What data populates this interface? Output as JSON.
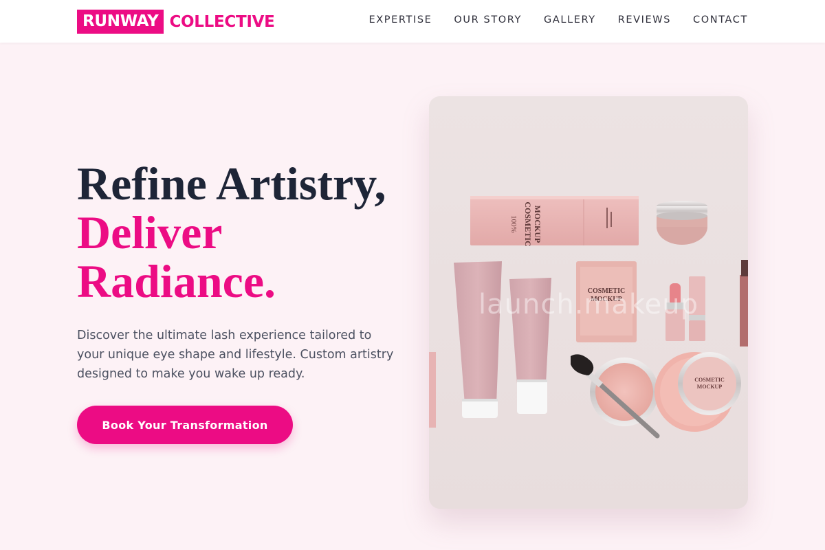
{
  "brand": {
    "logo_highlight": "RUNWAY",
    "logo_rest": "COLLECTIVE",
    "accent_color": "#ec0c84"
  },
  "nav": {
    "items": [
      {
        "label": "EXPERTISE"
      },
      {
        "label": "OUR STORY"
      },
      {
        "label": "GALLERY"
      },
      {
        "label": "REVIEWS"
      },
      {
        "label": "CONTACT"
      }
    ]
  },
  "hero": {
    "headline_line1": "Refine Artistry,",
    "headline_line2": "Deliver",
    "headline_line3": "Radiance.",
    "description": "Discover the ultimate lash experience tailored to your unique eye shape and lifestyle. Custom artistry designed to make you wake up ready.",
    "cta_label": "Book Your Transformation"
  },
  "image": {
    "watermark": "launch.makeup",
    "product_texts": {
      "box_brand": "100%",
      "box_line1": "COSMETIC",
      "box_line2": "MOCKUP",
      "sachet_line1": "COSMETIC",
      "sachet_line2": "MOCKUP",
      "jar_line1": "COSMETIC",
      "jar_line2": "MOCKUP"
    }
  }
}
